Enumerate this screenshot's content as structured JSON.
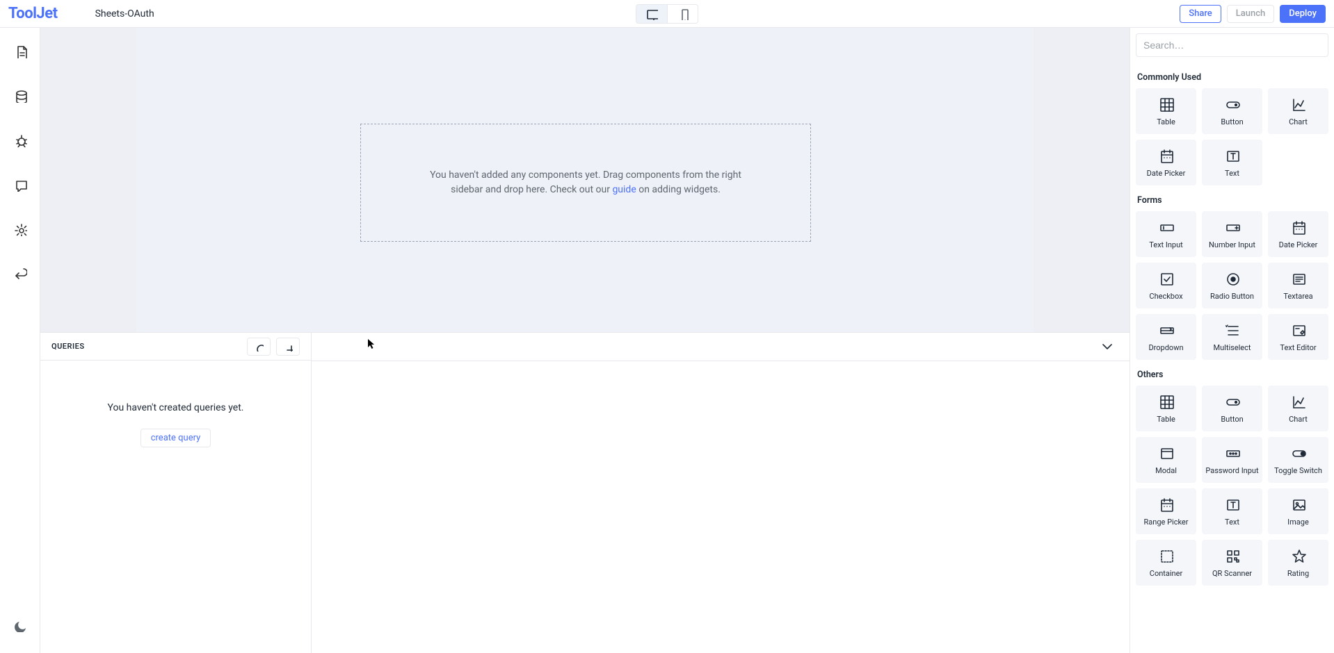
{
  "header": {
    "logo": "ToolJet",
    "app_title": "Sheets-OAuth",
    "share": "Share",
    "launch": "Launch",
    "deploy": "Deploy"
  },
  "canvas": {
    "empty_msg_pre": "You haven't added any components yet. Drag components from the right sidebar and drop here. Check out our ",
    "empty_link": "guide",
    "empty_msg_post": " on adding widgets."
  },
  "queries": {
    "title": "QUERIES",
    "empty_msg": "You haven't created queries yet.",
    "create_label": "create query"
  },
  "rightpanel": {
    "search_placeholder": "Search…",
    "sections": [
      {
        "title": "Commonly Used",
        "items": [
          {
            "label": "Table",
            "icon": "table"
          },
          {
            "label": "Button",
            "icon": "button"
          },
          {
            "label": "Chart",
            "icon": "chart"
          },
          {
            "label": "Date Picker",
            "icon": "calendar"
          },
          {
            "label": "Text",
            "icon": "text"
          }
        ]
      },
      {
        "title": "Forms",
        "items": [
          {
            "label": "Text Input",
            "icon": "textinput"
          },
          {
            "label": "Number Input",
            "icon": "numberinput"
          },
          {
            "label": "Date Picker",
            "icon": "calendar"
          },
          {
            "label": "Checkbox",
            "icon": "checkbox"
          },
          {
            "label": "Radio Button",
            "icon": "radio"
          },
          {
            "label": "Textarea",
            "icon": "textarea"
          },
          {
            "label": "Dropdown",
            "icon": "dropdown"
          },
          {
            "label": "Multiselect",
            "icon": "multiselect"
          },
          {
            "label": "Text Editor",
            "icon": "texteditor"
          }
        ]
      },
      {
        "title": "Others",
        "items": [
          {
            "label": "Table",
            "icon": "table"
          },
          {
            "label": "Button",
            "icon": "button"
          },
          {
            "label": "Chart",
            "icon": "chart"
          },
          {
            "label": "Modal",
            "icon": "modal"
          },
          {
            "label": "Password Input",
            "icon": "password"
          },
          {
            "label": "Toggle Switch",
            "icon": "toggle"
          },
          {
            "label": "Range Picker",
            "icon": "calendar"
          },
          {
            "label": "Text",
            "icon": "text"
          },
          {
            "label": "Image",
            "icon": "image"
          },
          {
            "label": "Container",
            "icon": "container"
          },
          {
            "label": "QR Scanner",
            "icon": "qr"
          },
          {
            "label": "Rating",
            "icon": "star"
          }
        ]
      }
    ]
  }
}
